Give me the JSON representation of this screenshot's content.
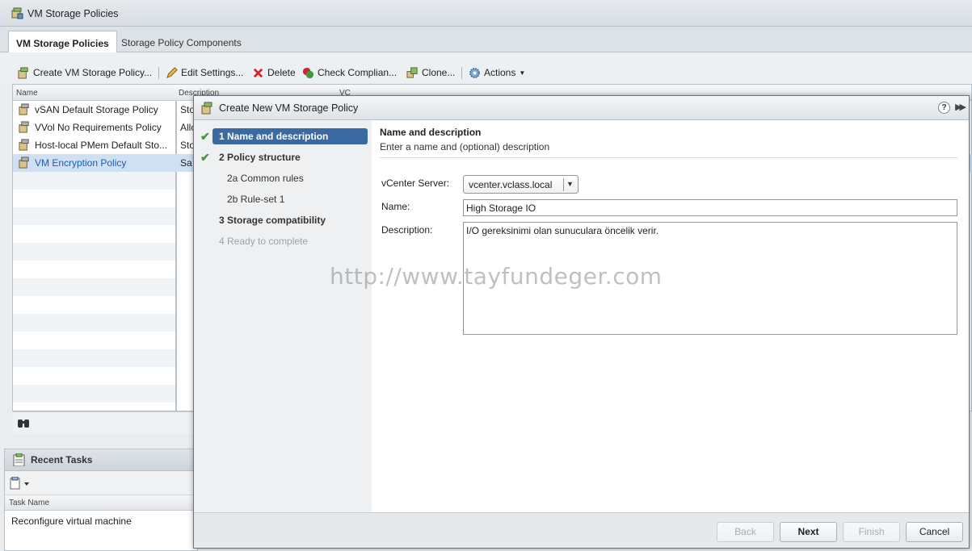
{
  "app": {
    "title": "VM Storage Policies"
  },
  "tabs": [
    {
      "label": "VM Storage Policies"
    },
    {
      "label": "Storage Policy Components"
    }
  ],
  "toolbar": {
    "create": "Create VM Storage Policy...",
    "edit": "Edit Settings...",
    "delete": "Delete",
    "check": "Check Complian...",
    "clone": "Clone...",
    "actions": "Actions"
  },
  "grid": {
    "columns": [
      "Name",
      "Description",
      "VC"
    ],
    "rows": [
      {
        "name": "vSAN Default Storage Policy",
        "desc": "Sto"
      },
      {
        "name": "VVol No Requirements Policy",
        "desc": "Allo"
      },
      {
        "name": "Host-local PMem Default Sto...",
        "desc": "Sto"
      },
      {
        "name": "VM Encryption Policy",
        "desc": "Sa"
      }
    ]
  },
  "recent_tasks": {
    "title": "Recent Tasks",
    "column": "Task Name",
    "rows": [
      "Reconfigure virtual machine"
    ]
  },
  "dialog": {
    "title": "Create New VM Storage Policy",
    "help": "?",
    "steps": [
      {
        "label": "1  Name and description"
      },
      {
        "label": "2  Policy structure"
      },
      {
        "label": "2a  Common rules"
      },
      {
        "label": "2b  Rule-set 1"
      },
      {
        "label": "3  Storage compatibility"
      },
      {
        "label": "4  Ready to complete"
      }
    ],
    "heading": "Name and description",
    "subheading": "Enter a name and (optional) description",
    "vcenter_label": "vCenter Server:",
    "vcenter_value": "vcenter.vclass.local",
    "name_label": "Name:",
    "name_value": "High Storage IO",
    "desc_label": "Description:",
    "desc_value": "I/O gereksinimi olan sunuculara öncelik verir.",
    "buttons": {
      "back": "Back",
      "next": "Next",
      "finish": "Finish",
      "cancel": "Cancel"
    }
  },
  "watermark": "http://www.tayfundeger.com"
}
